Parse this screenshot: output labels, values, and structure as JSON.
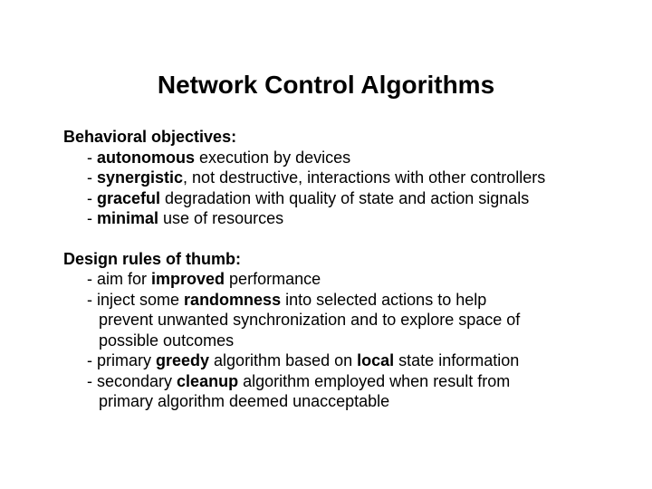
{
  "title": "Network Control Algorithms",
  "sections": {
    "behavioral": {
      "heading": "Behavioral objectives:",
      "items": {
        "i0": {
          "dash": "- ",
          "b": "autonomous",
          "rest": " execution by devices"
        },
        "i1": {
          "dash": "- ",
          "b": "synergistic",
          "rest": ", not destructive, interactions with other controllers"
        },
        "i2": {
          "dash": "- ",
          "b": "graceful",
          "rest": " degradation with quality of state and action signals"
        },
        "i3": {
          "dash": "- ",
          "b": "minimal",
          "rest": " use of resources"
        }
      }
    },
    "design": {
      "heading": "Design rules of thumb:",
      "items": {
        "i0": {
          "l0": "- aim for ",
          "b0": "improved",
          "l1": " performance"
        },
        "i1": {
          "l0": "- inject some ",
          "b0": "randomness",
          "l1": " into selected actions to help",
          "c1": "prevent unwanted synchronization and to explore space of",
          "c2": "possible outcomes"
        },
        "i2": {
          "l0": "- primary ",
          "b0": "greedy",
          "l1": " algorithm based on ",
          "b1": "local",
          "l2": " state information"
        },
        "i3": {
          "l0": "- secondary ",
          "b0": "cleanup",
          "l1": " algorithm employed when result from",
          "c1": "primary algorithm deemed unacceptable"
        }
      }
    }
  }
}
